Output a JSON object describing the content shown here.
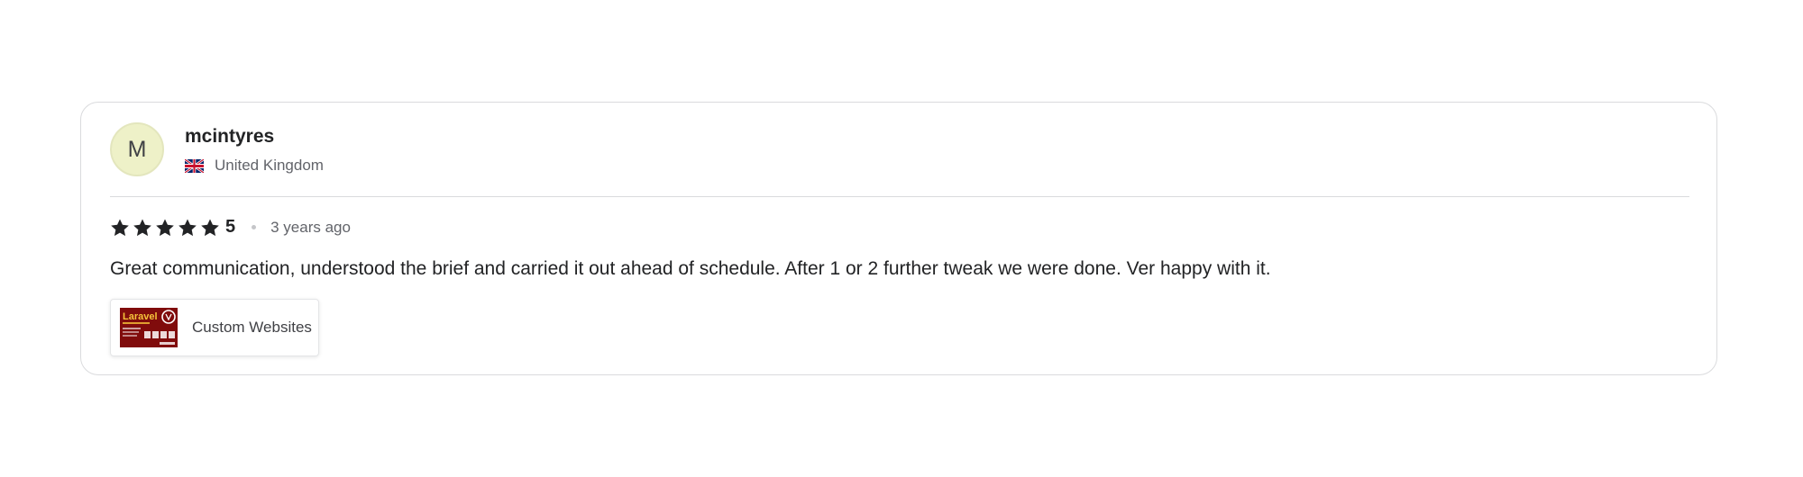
{
  "review": {
    "avatar_initial": "M",
    "username": "mcintyres",
    "country": "United Kingdom",
    "flag_icon": "uk-flag-icon",
    "rating": 5,
    "rating_label": "5",
    "time_ago": "3 years ago",
    "text": "Great communication, understood the brief and carried it out ahead of schedule. After 1 or 2 further tweak we were done. Ver happy with it.",
    "gig": {
      "title": "Custom Websites",
      "thumb_brand_text": "Laravel",
      "thumb_icon": "laravel-logo-icon"
    }
  },
  "colors": {
    "avatar_bg": "#eef1c8",
    "star": "#222325",
    "text_primary": "#222325",
    "text_secondary": "#62646a",
    "thumb_bg": "#8b0e0e",
    "thumb_brand": "#f6c33a"
  }
}
